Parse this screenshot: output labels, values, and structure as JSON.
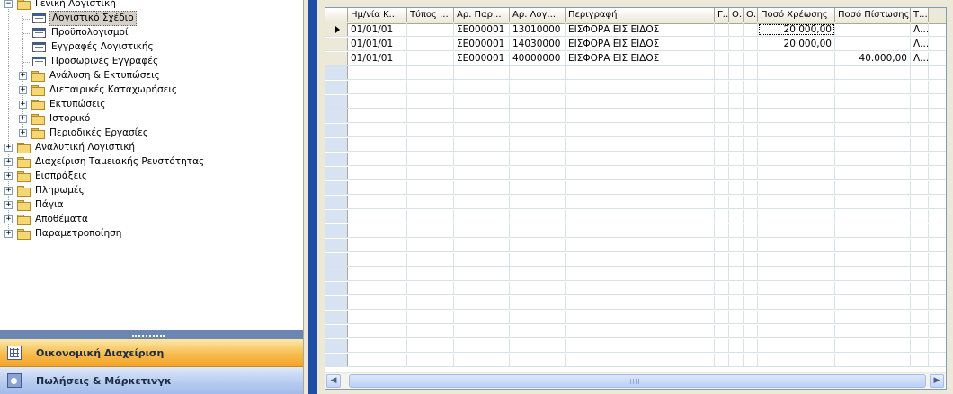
{
  "tree": {
    "items": [
      {
        "label": "Γενική Λογιστική",
        "level": 0,
        "icon": "folder-icon",
        "expander": "−"
      },
      {
        "label": "Λογιστικό Σχέδιο",
        "level": 1,
        "icon": "form-icon",
        "selected": true
      },
      {
        "label": "Προϋπολογισμοί",
        "level": 1,
        "icon": "form-icon"
      },
      {
        "label": "Εγγραφές Λογιστικής",
        "level": 1,
        "icon": "form-icon"
      },
      {
        "label": "Προσωρινές Εγγραφές",
        "level": 1,
        "icon": "form-icon"
      },
      {
        "label": "Ανάλυση & Εκτυπώσεις",
        "level": 1,
        "icon": "folder-icon",
        "expander": "+"
      },
      {
        "label": "Διεταιρικές Καταχωρήσεις",
        "level": 1,
        "icon": "folder-icon",
        "expander": "+"
      },
      {
        "label": "Εκτυπώσεις",
        "level": 1,
        "icon": "folder-icon",
        "expander": "+"
      },
      {
        "label": "Ιστορικό",
        "level": 1,
        "icon": "folder-icon",
        "expander": "+"
      },
      {
        "label": "Περιοδικές Εργασίες",
        "level": 1,
        "icon": "folder-icon",
        "expander": "+"
      },
      {
        "label": "Αναλυτική Λογιστική",
        "level": 0,
        "icon": "folder-icon",
        "expander": "+"
      },
      {
        "label": "Διαχείριση Ταμειακής Ρευστότητας",
        "level": 0,
        "icon": "folder-icon",
        "expander": "+"
      },
      {
        "label": "Εισπράξεις",
        "level": 0,
        "icon": "folder-icon",
        "expander": "+"
      },
      {
        "label": "Πληρωμές",
        "level": 0,
        "icon": "folder-icon",
        "expander": "+"
      },
      {
        "label": "Πάγια",
        "level": 0,
        "icon": "folder-icon",
        "expander": "+"
      },
      {
        "label": "Αποθέματα",
        "level": 0,
        "icon": "folder-icon",
        "expander": "+"
      },
      {
        "label": "Παραμετροποίηση",
        "level": 0,
        "icon": "folder-icon",
        "expander": "+"
      }
    ]
  },
  "nav": {
    "financial": "Οικονομική Διαχείριση",
    "sales": "Πωλήσεις & Μάρκετινγκ"
  },
  "grid": {
    "columns": [
      "Ημ/νία Κ...",
      "Τύπος ...",
      "Αρ. Παρ...",
      "Αρ. Λογ...",
      "Περιγραφή",
      "Γ...",
      "Ο...",
      "Ο...",
      "Ποσό Χρέωσης",
      "Ποσό Πίστωσης",
      "Τ..."
    ],
    "rows": [
      [
        "01/01/01",
        "",
        "ΣΕ000001",
        "13010000",
        "ΕΙΣΦΟΡΑ ΕΙΣ ΕΙΔΟΣ",
        "",
        "",
        "",
        "20.000,00",
        "",
        "Λ..."
      ],
      [
        "01/01/01",
        "",
        "ΣΕ000001",
        "14030000",
        "ΕΙΣΦΟΡΑ ΕΙΣ ΕΙΔΟΣ",
        "",
        "",
        "",
        "20.000,00",
        "",
        "Λ..."
      ],
      [
        "01/01/01",
        "",
        "ΣΕ000001",
        "40000000",
        "ΕΙΣΦΟΡΑ ΕΙΣ ΕΙΔΟΣ",
        "",
        "",
        "",
        "",
        "40.000,00",
        "Λ..."
      ]
    ],
    "empty_rows": 21
  },
  "scrollbar": {
    "left_arrow": "◀",
    "right_arrow": "▶"
  },
  "colors": {
    "accent_orange": "#f6b847",
    "accent_blue": "#1f4ea5",
    "grid_line": "#d8e0e8"
  }
}
